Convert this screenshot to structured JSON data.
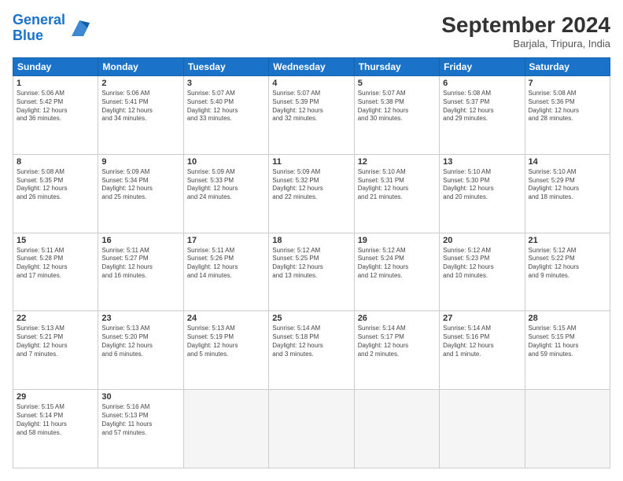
{
  "logo": {
    "line1": "General",
    "line2": "Blue"
  },
  "title": "September 2024",
  "location": "Barjala, Tripura, India",
  "weekdays": [
    "Sunday",
    "Monday",
    "Tuesday",
    "Wednesday",
    "Thursday",
    "Friday",
    "Saturday"
  ],
  "days": [
    {
      "num": "1",
      "sunrise": "5:06 AM",
      "sunset": "5:42 PM",
      "daylight": "12 hours and 36 minutes."
    },
    {
      "num": "2",
      "sunrise": "5:06 AM",
      "sunset": "5:41 PM",
      "daylight": "12 hours and 34 minutes."
    },
    {
      "num": "3",
      "sunrise": "5:07 AM",
      "sunset": "5:40 PM",
      "daylight": "12 hours and 33 minutes."
    },
    {
      "num": "4",
      "sunrise": "5:07 AM",
      "sunset": "5:39 PM",
      "daylight": "12 hours and 32 minutes."
    },
    {
      "num": "5",
      "sunrise": "5:07 AM",
      "sunset": "5:38 PM",
      "daylight": "12 hours and 30 minutes."
    },
    {
      "num": "6",
      "sunrise": "5:08 AM",
      "sunset": "5:37 PM",
      "daylight": "12 hours and 29 minutes."
    },
    {
      "num": "7",
      "sunrise": "5:08 AM",
      "sunset": "5:36 PM",
      "daylight": "12 hours and 28 minutes."
    },
    {
      "num": "8",
      "sunrise": "5:08 AM",
      "sunset": "5:35 PM",
      "daylight": "12 hours and 26 minutes."
    },
    {
      "num": "9",
      "sunrise": "5:09 AM",
      "sunset": "5:34 PM",
      "daylight": "12 hours and 25 minutes."
    },
    {
      "num": "10",
      "sunrise": "5:09 AM",
      "sunset": "5:33 PM",
      "daylight": "12 hours and 24 minutes."
    },
    {
      "num": "11",
      "sunrise": "5:09 AM",
      "sunset": "5:32 PM",
      "daylight": "12 hours and 22 minutes."
    },
    {
      "num": "12",
      "sunrise": "5:10 AM",
      "sunset": "5:31 PM",
      "daylight": "12 hours and 21 minutes."
    },
    {
      "num": "13",
      "sunrise": "5:10 AM",
      "sunset": "5:30 PM",
      "daylight": "12 hours and 20 minutes."
    },
    {
      "num": "14",
      "sunrise": "5:10 AM",
      "sunset": "5:29 PM",
      "daylight": "12 hours and 18 minutes."
    },
    {
      "num": "15",
      "sunrise": "5:11 AM",
      "sunset": "5:28 PM",
      "daylight": "12 hours and 17 minutes."
    },
    {
      "num": "16",
      "sunrise": "5:11 AM",
      "sunset": "5:27 PM",
      "daylight": "12 hours and 16 minutes."
    },
    {
      "num": "17",
      "sunrise": "5:11 AM",
      "sunset": "5:26 PM",
      "daylight": "12 hours and 14 minutes."
    },
    {
      "num": "18",
      "sunrise": "5:12 AM",
      "sunset": "5:25 PM",
      "daylight": "12 hours and 13 minutes."
    },
    {
      "num": "19",
      "sunrise": "5:12 AM",
      "sunset": "5:24 PM",
      "daylight": "12 hours and 12 minutes."
    },
    {
      "num": "20",
      "sunrise": "5:12 AM",
      "sunset": "5:23 PM",
      "daylight": "12 hours and 10 minutes."
    },
    {
      "num": "21",
      "sunrise": "5:12 AM",
      "sunset": "5:22 PM",
      "daylight": "12 hours and 9 minutes."
    },
    {
      "num": "22",
      "sunrise": "5:13 AM",
      "sunset": "5:21 PM",
      "daylight": "12 hours and 7 minutes."
    },
    {
      "num": "23",
      "sunrise": "5:13 AM",
      "sunset": "5:20 PM",
      "daylight": "12 hours and 6 minutes."
    },
    {
      "num": "24",
      "sunrise": "5:13 AM",
      "sunset": "5:19 PM",
      "daylight": "12 hours and 5 minutes."
    },
    {
      "num": "25",
      "sunrise": "5:14 AM",
      "sunset": "5:18 PM",
      "daylight": "12 hours and 3 minutes."
    },
    {
      "num": "26",
      "sunrise": "5:14 AM",
      "sunset": "5:17 PM",
      "daylight": "12 hours and 2 minutes."
    },
    {
      "num": "27",
      "sunrise": "5:14 AM",
      "sunset": "5:16 PM",
      "daylight": "12 hours and 1 minute."
    },
    {
      "num": "28",
      "sunrise": "5:15 AM",
      "sunset": "5:15 PM",
      "daylight": "11 hours and 59 minutes."
    },
    {
      "num": "29",
      "sunrise": "5:15 AM",
      "sunset": "5:14 PM",
      "daylight": "11 hours and 58 minutes."
    },
    {
      "num": "30",
      "sunrise": "5:16 AM",
      "sunset": "5:13 PM",
      "daylight": "11 hours and 57 minutes."
    }
  ]
}
